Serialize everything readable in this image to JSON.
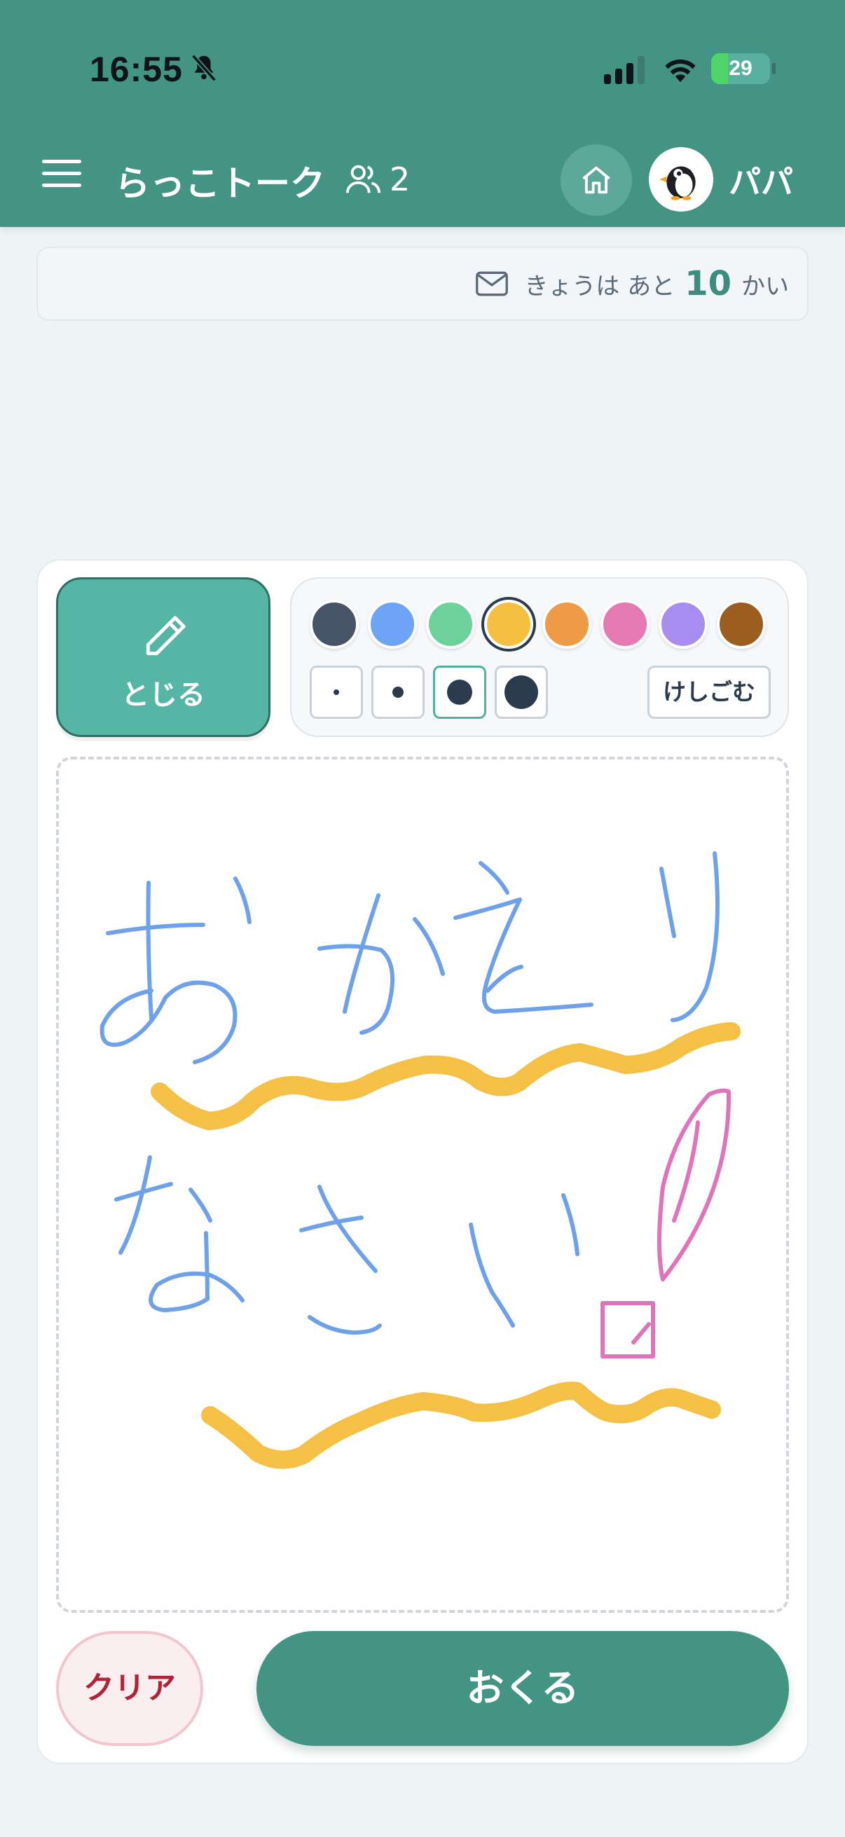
{
  "status_bar": {
    "time": "16:55",
    "battery_level": "29",
    "icons": [
      "bell-slash-icon",
      "signal-icon",
      "wifi-icon",
      "battery-charging-icon"
    ]
  },
  "header": {
    "app_title": "らっこトーク",
    "member_count": "2",
    "user_name": "パパ",
    "icons": [
      "menu-icon",
      "people-icon",
      "home-icon",
      "penguin-avatar-icon"
    ]
  },
  "quota": {
    "prefix": "きょうは あと",
    "count": "10",
    "suffix": "かい"
  },
  "toolbar": {
    "close_label": "とじる",
    "eraser_label": "けしごむ",
    "colors": [
      "#475467",
      "#6ea4f5",
      "#6cd29a",
      "#f5c042",
      "#ef9a47",
      "#e57ab3",
      "#a88cf0",
      "#9b5e1e"
    ],
    "selected_color": "#f5c042",
    "brush_sizes": [
      "xs",
      "s",
      "m",
      "l"
    ],
    "selected_size": "m"
  },
  "drawing": {
    "handwritten_text": [
      "おかえり",
      "なさい",
      "!"
    ]
  },
  "actions": {
    "clear_label": "クリア",
    "send_label": "おくる"
  }
}
